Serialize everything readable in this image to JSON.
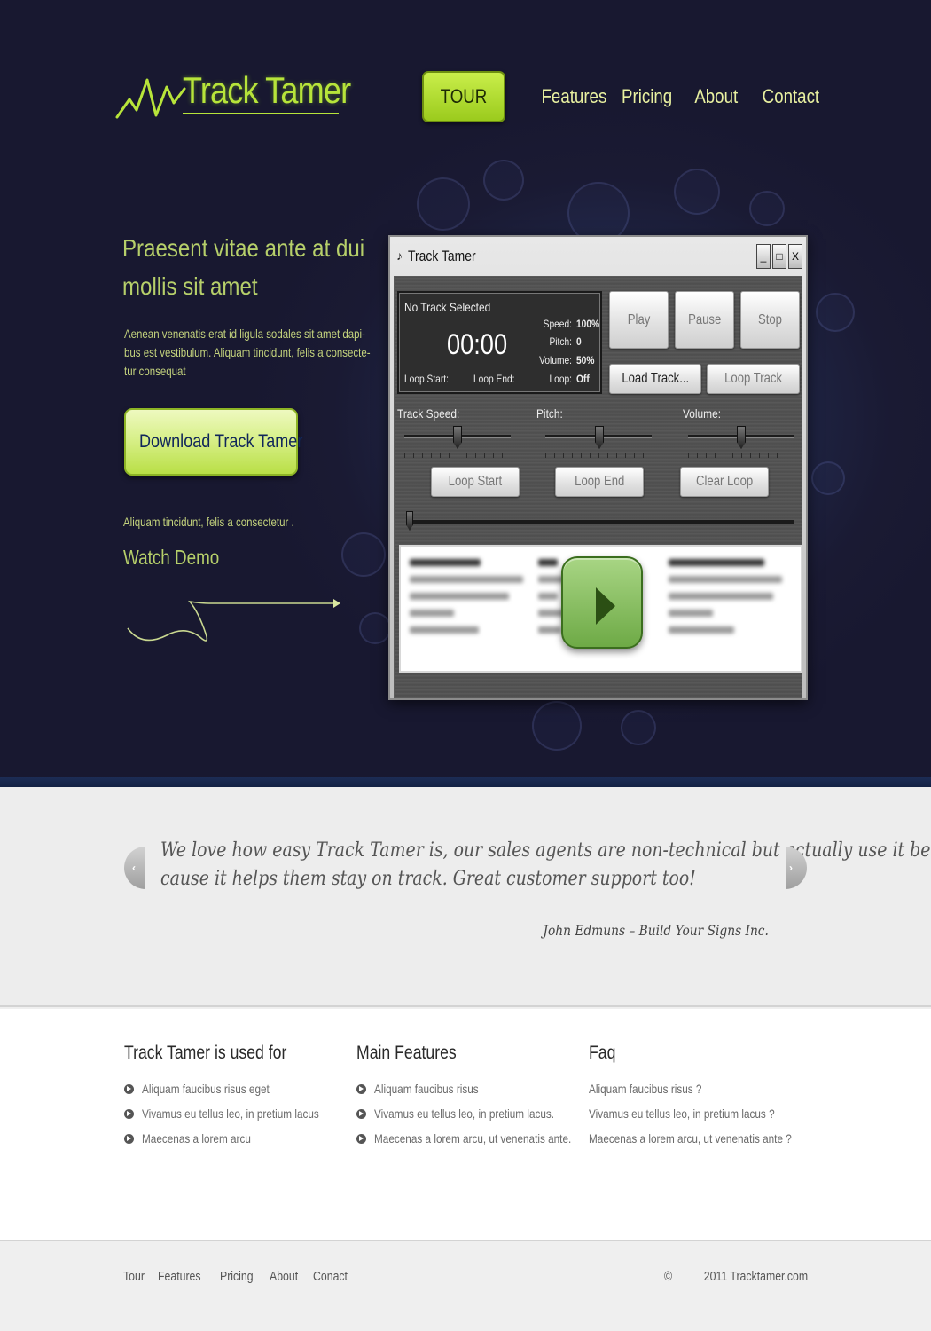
{
  "brand": {
    "name": "Track Tamer",
    "accent": "#b7e43a"
  },
  "nav": {
    "tour": "TOUR",
    "links": [
      "Features",
      "Pricing",
      "About",
      "Contact"
    ]
  },
  "hero": {
    "title_line1": "Praesent vitae ante at dui",
    "title_line2": "mollis sit amet",
    "desc_lines": [
      "Aenean venenatis erat id ligula sodales sit amet dapi-",
      "bus est vestibulum. Aliquam tincidunt, felis a consecte-",
      "tur consequat"
    ],
    "download_label": "Download Track Tamer",
    "small_text": "Aliquam tincidunt, felis a consectetur .",
    "watch_demo": "Watch Demo"
  },
  "app": {
    "window_title": "Track Tamer",
    "window_buttons": [
      "_",
      "□",
      "X"
    ],
    "status": "No Track Selected",
    "time": "00:00",
    "loop_start_label": "Loop Start:",
    "loop_end_label": "Loop End:",
    "stats": [
      {
        "label": "Speed:",
        "value": "100%"
      },
      {
        "label": "Pitch:",
        "value": "0"
      },
      {
        "label": "Volume:",
        "value": "50%"
      },
      {
        "label": "Loop:",
        "value": "Off"
      }
    ],
    "buttons": {
      "play": "Play",
      "pause": "Pause",
      "stop": "Stop",
      "load": "Load Track...",
      "loop_track": "Loop Track",
      "loop_start": "Loop Start",
      "loop_end": "Loop End",
      "clear_loop": "Clear Loop"
    },
    "sliders": {
      "speed_label": "Track Speed:",
      "pitch_label": "Pitch:",
      "volume_label": "Volume:"
    }
  },
  "testimonial": {
    "line1": "We love how easy Track Tamer is, our sales agents are non-technical but actually use it be-",
    "line2": "cause it helps them stay on track. Great customer support too!",
    "author": "John Edmuns – Build Your Signs Inc."
  },
  "columns": {
    "used_for": {
      "title": "Track Tamer is used for",
      "items": [
        "Aliquam faucibus risus eget",
        "Vivamus eu tellus leo, in pretium lacus",
        "Maecenas a lorem arcu"
      ]
    },
    "features": {
      "title": "Main Features",
      "items": [
        "Aliquam faucibus risus",
        "Vivamus eu tellus leo, in pretium lacus.",
        "Maecenas a lorem arcu, ut venenatis ante."
      ]
    },
    "faq": {
      "title": "Faq",
      "items": [
        "Aliquam faucibus risus ?",
        "Vivamus eu tellus leo, in pretium lacus ?",
        "Maecenas a lorem arcu, ut venenatis ante ?"
      ]
    }
  },
  "footer": {
    "links": [
      "Tour",
      "Features",
      "Pricing",
      "About",
      "Conact"
    ],
    "copyright_symbol": "©",
    "copyright": "2011 Tracktamer.com"
  }
}
